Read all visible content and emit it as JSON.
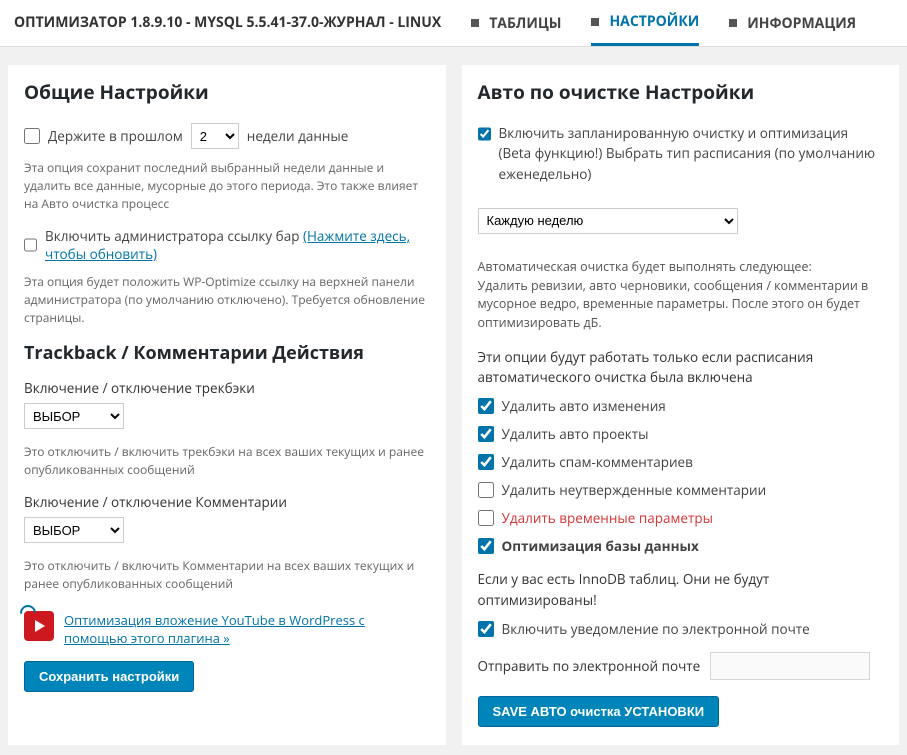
{
  "header": {
    "title": "ОПТИМИЗАТОР 1.8.9.10 - MYSQL 5.5.41-37.0-ЖУРНАЛ - LINUX",
    "tabs": [
      {
        "label": "ТАБЛИЦЫ"
      },
      {
        "label": "НАСТРОЙКИ"
      },
      {
        "label": "ИНФОРМАЦИЯ"
      }
    ]
  },
  "left": {
    "heading": "Общие Настройки",
    "keep_past_prefix": "Держите в прошлом",
    "keep_past_value": "2",
    "keep_past_options": [
      "2"
    ],
    "keep_past_suffix": "недели данные",
    "keep_past_desc": "Эта опция сохранит последний выбранный недели данные и удалить все данные, мусорные до этого периода. Это также влияет на Авто очистка процесс",
    "admin_link_label": "Включить администратора ссылку бар",
    "admin_link_link": "(Нажмите здесь, чтобы обновить)",
    "admin_link_desc": "Эта опция будет положить WP-Optimize ссылку на верхней панели администратора (по умолчанию отключено). Требуется обновление страницы.",
    "trackback_heading": "Trackback / Комментарии Действия",
    "trackback_label": "Включение / отключение трекбэки",
    "trackback_select": "ВЫБОР",
    "trackback_options": [
      "ВЫБОР"
    ],
    "trackback_desc": "Это отключить / включить трекбэки на всех ваших текущих и ранее опубликованных сообщений",
    "comments_label": "Включение / отключение Комментарии",
    "comments_select": "ВЫБОР",
    "comments_options": [
      "ВЫБОР"
    ],
    "comments_desc": "Это отключить / включить Комментарии на всех ваших текущих и ранее опубликованных сообщений",
    "youtube_link": "Оптимизация вложение YouTube в WordPress с помощью этого плагина »",
    "save_button": "Сохранить настройки"
  },
  "right": {
    "heading": "Авто по очистке Настройки",
    "enable_label": "Включить запланированную очистку и оптимизация (Beta функцию!) Выбрать тип расписания (по умолчанию еженедельно)",
    "schedule_value": "Каждую неделю",
    "schedule_options": [
      "Каждую неделю"
    ],
    "auto_desc": "Автоматическая очистка будет выполнять следующее:\nУдалить ревизии, авто черновики, сообщения / комментарии в мусорное ведро, временные параметры. После этого он будет оптимизировать дБ.",
    "auto_note": "Эти опции будут работать только если расписания автоматического очистка была включена",
    "opts": {
      "revisions": "Удалить авто изменения",
      "drafts": "Удалить авто проекты",
      "spam": "Удалить спам-комментариев",
      "unapproved": "Удалить неутвержденные комментарии",
      "transients": "Удалить временные параметры",
      "optimize": "Оптимизация базы данных"
    },
    "innodb_note": "Если у вас есть InnoDB таблиц. Они не будут оптимизированы!",
    "email_enable": "Включить уведомление по электронной почте",
    "email_label": "Отправить по электронной почте",
    "email_value": "",
    "save_button": "SAVE АВТО очистка УСТАНОВКИ"
  }
}
